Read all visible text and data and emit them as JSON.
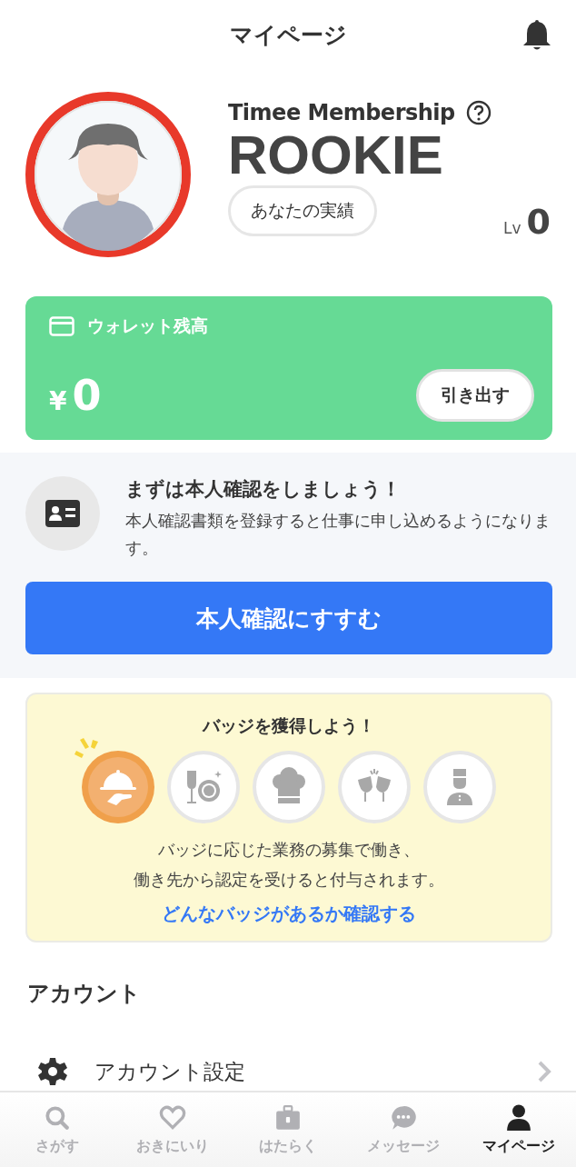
{
  "header": {
    "title": "マイページ"
  },
  "profile": {
    "membership": "Timee Membership",
    "rank": "ROOKIE",
    "achievements_button": "あなたの実績",
    "level_label": "Lv",
    "level_value": "0"
  },
  "wallet": {
    "title": "ウォレット残高",
    "currency": "¥",
    "amount": "0",
    "withdraw_button": "引き出す"
  },
  "verification": {
    "title": "まずは本人確認をしましょう！",
    "description": "本人確認書類を登録すると仕事に申し込めるようになります。",
    "button": "本人確認にすすむ"
  },
  "badges": {
    "title": "バッジを獲得しよう！",
    "items": [
      {
        "kind": "cloche",
        "earned": true
      },
      {
        "kind": "dishes",
        "earned": false
      },
      {
        "kind": "chef",
        "earned": false
      },
      {
        "kind": "toast",
        "earned": false
      },
      {
        "kind": "bellhop",
        "earned": false
      }
    ],
    "description_lines": [
      "バッジに応じた業務の募集で働き、",
      "働き先から認定を受けると付与されます。"
    ],
    "link": "どんなバッジがあるか確認する"
  },
  "account": {
    "heading": "アカウント",
    "items": [
      {
        "label": "アカウント設定"
      }
    ]
  },
  "tab_bar": [
    {
      "label": "さがす",
      "kind": "search",
      "selected": false
    },
    {
      "label": "おきにいり",
      "kind": "heart",
      "selected": false
    },
    {
      "label": "はたらく",
      "kind": "briefcase",
      "selected": false
    },
    {
      "label": "メッセージ",
      "kind": "chat",
      "selected": false
    },
    {
      "label": "マイページ",
      "kind": "person",
      "selected": true
    }
  ]
}
